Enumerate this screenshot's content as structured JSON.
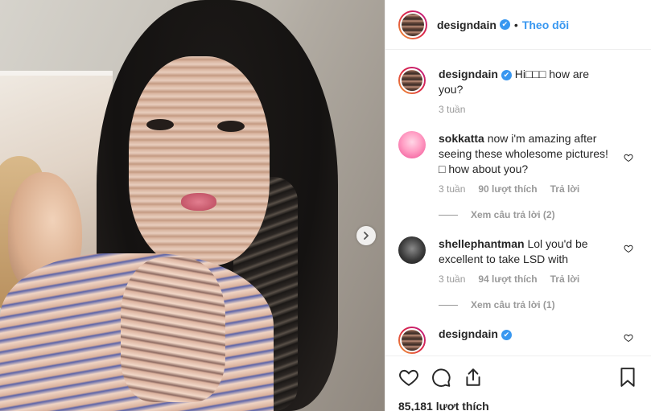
{
  "post": {
    "username": "designdain",
    "verified_mark": "✔",
    "dot": "•",
    "follow_label": "Theo dõi",
    "next_icon": "chevron-right-icon"
  },
  "comments": [
    {
      "username": "designdain",
      "text": "Hi□□□ how are you?",
      "time": "3 tuần",
      "verified": true
    },
    {
      "username": "sokkatta",
      "text": "now i'm amazing after seeing these wholesome pictures! □ how about you?",
      "time": "3 tuần",
      "likes": "90 lượt thích",
      "reply": "Trả lời",
      "view_replies": "Xem câu trả lời (2)"
    },
    {
      "username": "shellephantman",
      "text": "Lol you'd be excellent to take LSD with",
      "time": "3 tuần",
      "likes": "94 lượt thích",
      "reply": "Trả lời",
      "view_replies": "Xem câu trả lời (1)"
    },
    {
      "username": "designdain",
      "verified": true
    }
  ],
  "footer": {
    "likes_count": "85,181 lượt thích"
  },
  "colors": {
    "accent": "#3897f0",
    "muted": "#999999",
    "text": "#262626",
    "border": "#efefef"
  }
}
